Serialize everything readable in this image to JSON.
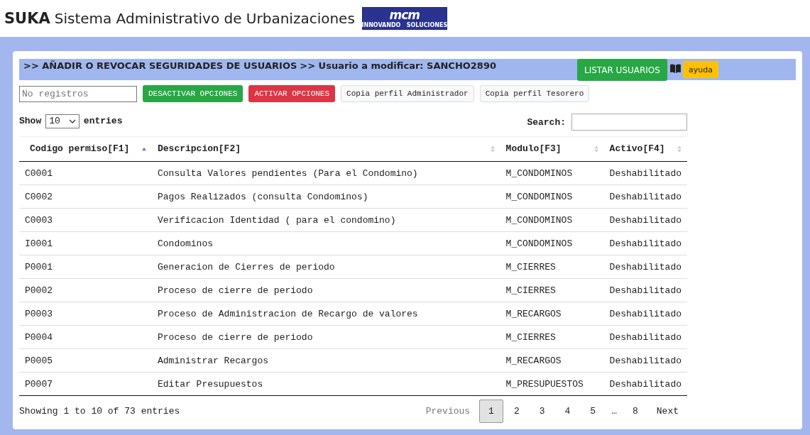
{
  "header": {
    "brand": "SUKA",
    "title": "Sistema Administrativo de Urbanizaciones",
    "logo": {
      "mark": "mcm",
      "tagline": "INNOVANDO   SOLUCIONES"
    }
  },
  "title_bar": {
    "section": ">> AÑADIR O REVOCAR SEGURIDADES DE USUARIOS",
    "user": ">> Usuario a modificar: SANCHO2890",
    "list_button": "LISTAR USUARIOS",
    "help_button": "ayuda"
  },
  "toolbar": {
    "records_field": {
      "placeholder": "No registros"
    },
    "buttons": [
      {
        "label": "DESACTIVAR OPCIONES",
        "kind": "success"
      },
      {
        "label": "ACTIVAR OPCIONES",
        "kind": "danger"
      },
      {
        "label": "Copia perfil Administrador",
        "kind": "light"
      },
      {
        "label": "Copia perfil Tesorero",
        "kind": "light"
      }
    ]
  },
  "length": {
    "before": "Show",
    "value": "10",
    "after": "entries"
  },
  "search": {
    "label": "Search:"
  },
  "table": {
    "columns": [
      {
        "label": "Codigo permiso[F1]",
        "sorted": true
      },
      {
        "label": "Descripcion[F2]",
        "sorted": false
      },
      {
        "label": "Modulo[F3]",
        "sorted": false
      },
      {
        "label": "Activo[F4]",
        "sorted": false
      }
    ],
    "rows": [
      [
        "C0001",
        "Consulta Valores pendientes (Para el Condomino)",
        "M_CONDOMINOS",
        "Deshabilitado"
      ],
      [
        "C0002",
        "Pagos Realizados (consulta Condominos)",
        "M_CONDOMINOS",
        "Deshabilitado"
      ],
      [
        "C0003",
        "Verificacion Identidad ( para el condomino)",
        "M_CONDOMINOS",
        "Deshabilitado"
      ],
      [
        "I0001",
        "Condominos",
        "M_CONDOMINOS",
        "Deshabilitado"
      ],
      [
        "P0001",
        "Generacion de Cierres de periodo",
        "M_CIERRES",
        "Deshabilitado"
      ],
      [
        "P0002",
        "Proceso de cierre de periodo",
        "M_CIERRES",
        "Deshabilitado"
      ],
      [
        "P0003",
        "Proceso de Administracion de Recargo de valores",
        "M_RECARGOS",
        "Deshabilitado"
      ],
      [
        "P0004",
        "Proceso de cierre de periodo",
        "M_CIERRES",
        "Deshabilitado"
      ],
      [
        "P0005",
        "Administrar Recargos",
        "M_RECARGOS",
        "Deshabilitado"
      ],
      [
        "P0007",
        "Editar Presupuestos",
        "M_PRESUPUESTOS",
        "Deshabilitado"
      ]
    ]
  },
  "info": "Showing 1 to 10 of 73 entries",
  "pagination": {
    "previous": {
      "label": "Previous",
      "disabled": true
    },
    "pages": [
      {
        "label": "1",
        "selected": true
      },
      {
        "label": "2",
        "selected": false
      },
      {
        "label": "3",
        "selected": false
      },
      {
        "label": "4",
        "selected": false
      },
      {
        "label": "5",
        "selected": false
      },
      {
        "label": "…",
        "kind": "ellipsis"
      },
      {
        "label": "8",
        "selected": false
      }
    ],
    "next": {
      "label": "Next",
      "disabled": false
    }
  }
}
